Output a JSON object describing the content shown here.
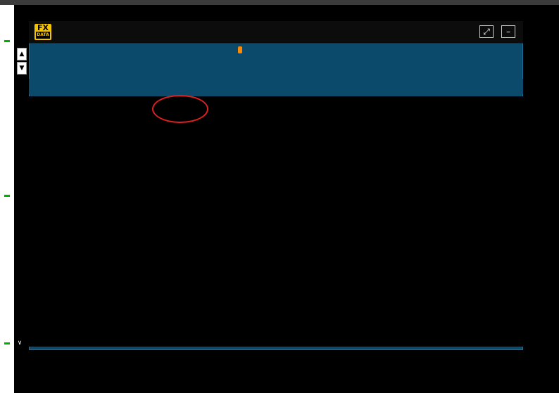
{
  "app": {
    "title": "",
    "promo_red": "",
    "promo_white": ""
  },
  "platform_bar": [],
  "toolbar": {
    "buttons": [],
    "badges": [],
    "hot": ""
  },
  "account_info": [],
  "side_buttons": [],
  "sidebar_tabs": [],
  "table": {
    "headers": [],
    "rows": []
  },
  "summary": {
    "label": "",
    "values": []
  },
  "footer": [],
  "watermark": "",
  "colors": {
    "panel": "#0c4a6b",
    "header_bg": "#0c0c0c",
    "red": "#ff2d2d",
    "green": "#22e033",
    "white": "#dcdcdc",
    "footer_bg": "#14486a"
  }
}
